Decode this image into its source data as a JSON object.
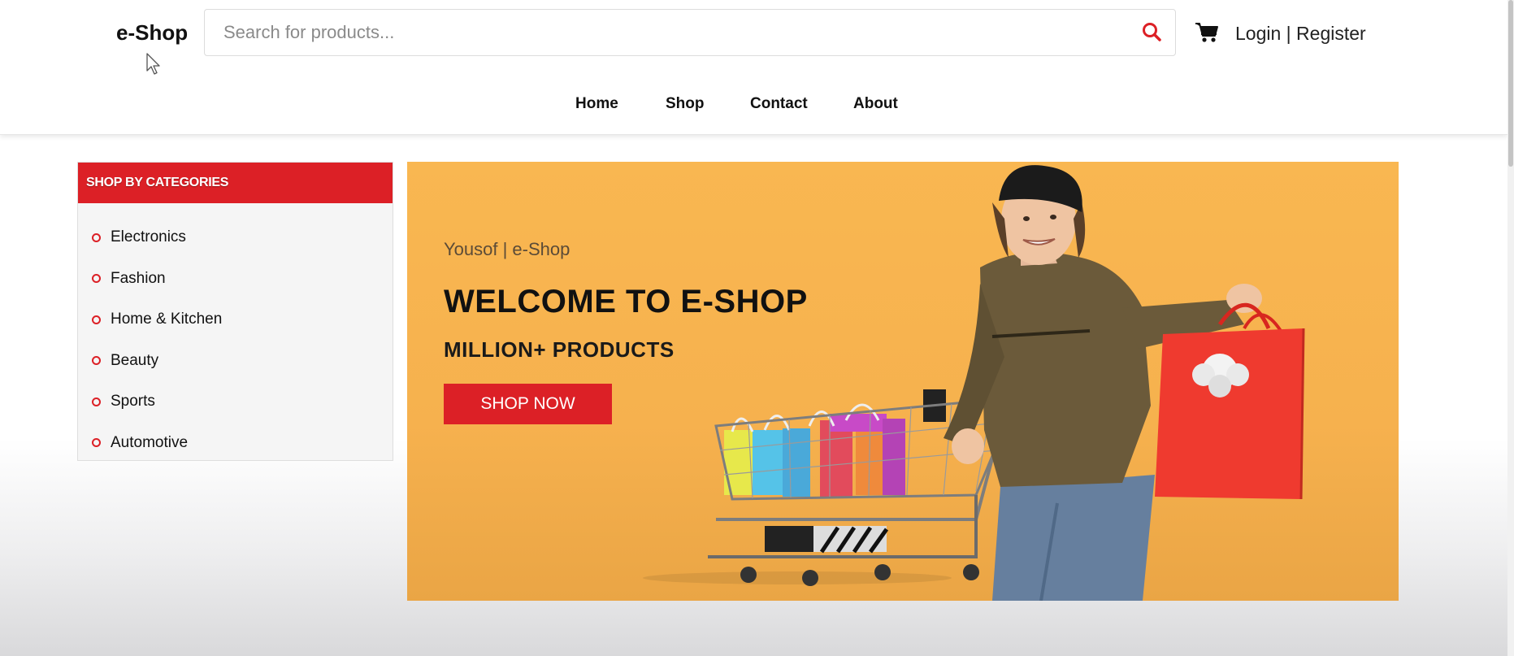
{
  "header": {
    "logo": "e-Shop",
    "search": {
      "placeholder": "Search for products...",
      "value": ""
    },
    "auth": {
      "login": "Login",
      "separator": "|",
      "register": "Register"
    },
    "nav": [
      {
        "label": "Home"
      },
      {
        "label": "Shop"
      },
      {
        "label": "Contact"
      },
      {
        "label": "About"
      }
    ]
  },
  "sidebar": {
    "title": "SHOP BY CATEGORIES",
    "items": [
      {
        "label": "Electronics"
      },
      {
        "label": "Fashion"
      },
      {
        "label": "Home & Kitchen"
      },
      {
        "label": "Beauty"
      },
      {
        "label": "Sports"
      },
      {
        "label": "Automotive"
      }
    ]
  },
  "banner": {
    "tagline": "Yousof | e-Shop",
    "title": "WELCOME TO E-SHOP",
    "subtitle": "MILLION+ PRODUCTS",
    "button": "SHOP NOW"
  },
  "colors": {
    "accent": "#dc2026",
    "banner_bg": "#f9b751"
  },
  "icons": {
    "search": "search-icon",
    "cart": "cart-icon",
    "cursor": "mouse-cursor-icon"
  }
}
